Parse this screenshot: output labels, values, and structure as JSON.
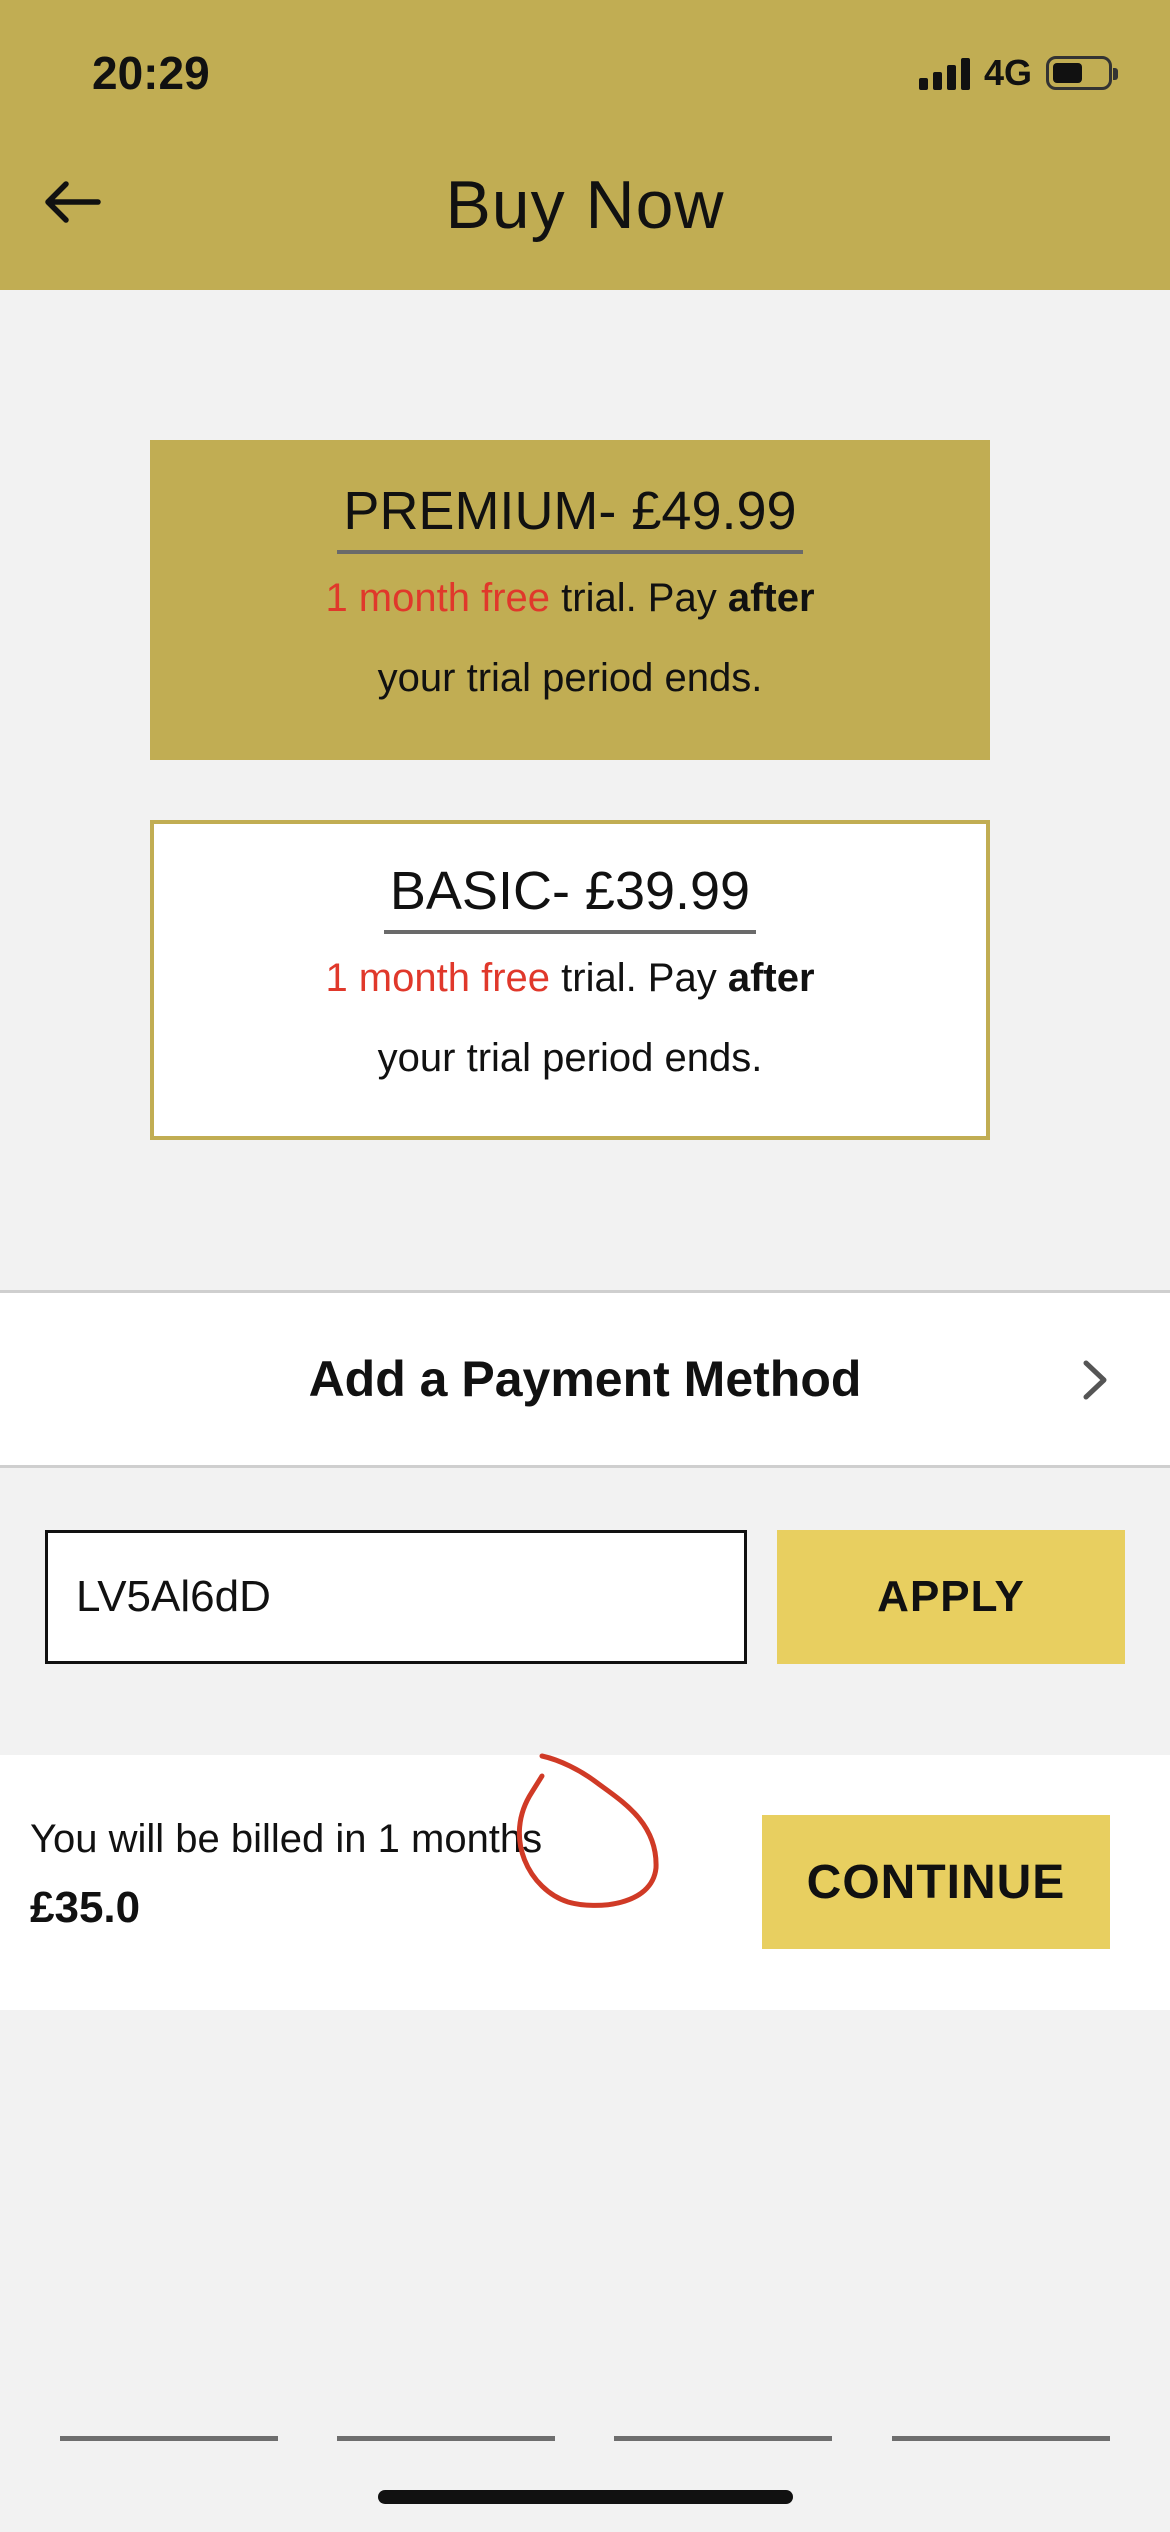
{
  "status_bar": {
    "time": "20:29",
    "network": "4G"
  },
  "header": {
    "title": "Buy Now",
    "back_icon": "arrow-left-icon",
    "background_color": "#c1ad53"
  },
  "plans": [
    {
      "title": "PREMIUM- £49.99",
      "free_text": "1 month free",
      "trial_text": " trial. Pay ",
      "after_text": "after",
      "ends_text": "your trial period ends.",
      "selected": true
    },
    {
      "title": "BASIC- £39.99",
      "free_text": "1 month free",
      "trial_text": " trial. Pay ",
      "after_text": "after",
      "ends_text": "your trial period ends.",
      "selected": false
    }
  ],
  "payment": {
    "label": "Add a Payment Method",
    "icon": "chevron-right-icon"
  },
  "promo": {
    "value": "LV5Al6dD",
    "apply_label": "APPLY"
  },
  "billing": {
    "text": "You will be billed in 1 months",
    "amount": "£35.0",
    "continue_label": "CONTINUE"
  },
  "colors": {
    "accent": "#c1ad53",
    "button": "#e8cf60",
    "highlight_red": "#e0382b"
  }
}
